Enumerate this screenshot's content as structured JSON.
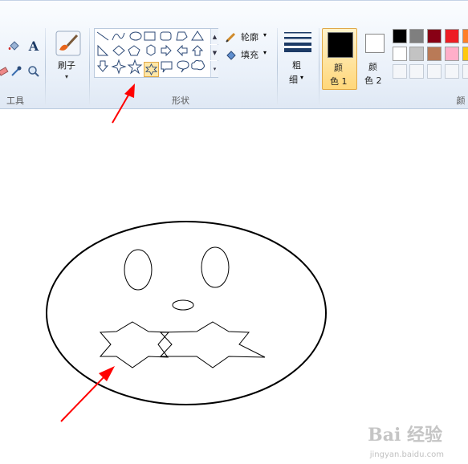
{
  "tools_group": {
    "label": "工具"
  },
  "brush": {
    "label": "刷子"
  },
  "shapes_group": {
    "label": "形状",
    "outline_label": "轮廓",
    "fill_label": "填充",
    "selected_shape": "star-6-point"
  },
  "size": {
    "label_line1": "粗",
    "label_line2": "细"
  },
  "color1": {
    "label_line1": "颜",
    "label_line2": "色 1",
    "value": "#000000"
  },
  "color2": {
    "label_line1": "颜",
    "label_line2": "色 2",
    "value": "#ffffff"
  },
  "colors_group": {
    "label": "颜"
  },
  "palette": [
    "#000000",
    "#7f7f7f",
    "#880015",
    "#ed1c24",
    "#ffffff",
    "#c3c3c3",
    "#b97a57",
    "#ffaec9"
  ],
  "accent": "#ff0000",
  "watermark": {
    "brand": "Bai 经验",
    "url": "jingyan.baidu.com"
  }
}
